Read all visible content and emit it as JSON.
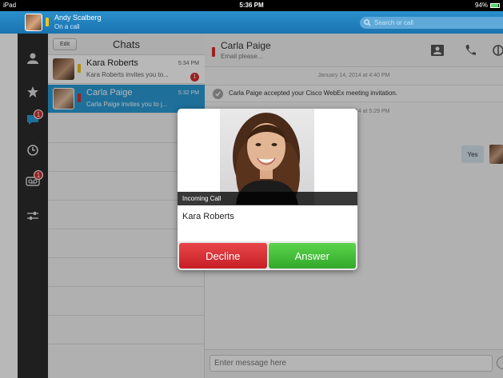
{
  "status_bar": {
    "carrier": "iPad",
    "time": "5:36 PM",
    "battery": "94%",
    "battery_level": 0.94
  },
  "header": {
    "user_name": "Andy Scalberg",
    "user_status": "On a call",
    "search_placeholder": "Search or call"
  },
  "nav": {
    "items": [
      {
        "icon": "contacts-icon"
      },
      {
        "icon": "favorites-star-icon"
      },
      {
        "icon": "chat-bubble-icon",
        "badge": "1"
      },
      {
        "icon": "recents-clock-icon"
      },
      {
        "icon": "voicemail-icon",
        "badge": "1"
      },
      {
        "icon": "settings-sliders-icon"
      }
    ]
  },
  "chats": {
    "edit_label": "Edit",
    "title": "Chats",
    "items": [
      {
        "name": "Kara Roberts",
        "snippet": "Kara Roberts invites you to...",
        "time": "5:34 PM",
        "badge": "1",
        "presence_color": "#f0c419"
      },
      {
        "name": "Carla Paige",
        "snippet": "Carla Paige invites you to j...",
        "time": "5:32 PM",
        "presence_color": "#d32f2f"
      }
    ]
  },
  "conversation": {
    "contact_name": "Carla Paige",
    "contact_status": "Email please...",
    "date_separator_1": "January 14, 2014 at 4:40 PM",
    "system_message": "Carla Paige accepted your Cisco WebEx meeting invitation.",
    "date_separator_2": "January 14, 2014 at 5:29 PM",
    "reply_text": "Yes",
    "composer_placeholder": "Enter message here"
  },
  "incoming_call": {
    "banner": "Incoming Call",
    "caller_name": "Kara Roberts",
    "decline_label": "Decline",
    "answer_label": "Answer"
  }
}
